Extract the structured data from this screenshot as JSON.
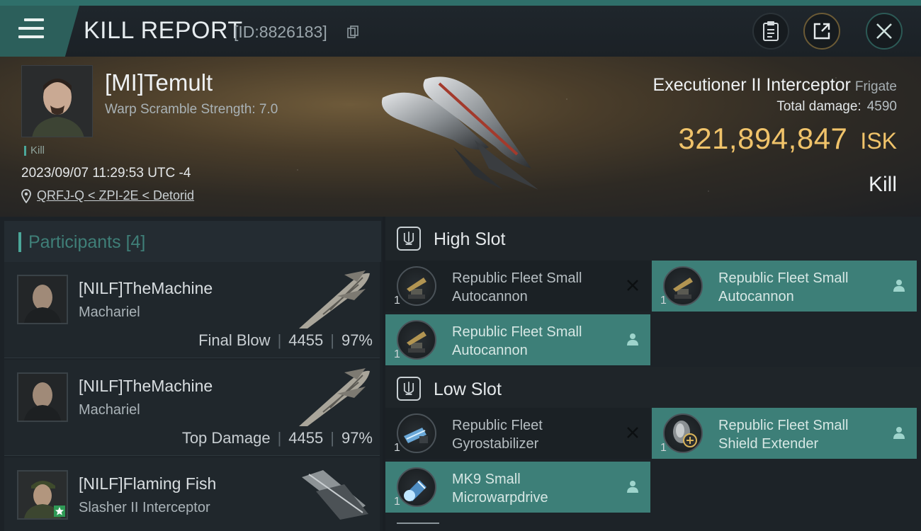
{
  "header": {
    "title": "KILL REPORT",
    "report_id": "[ID:8826183]",
    "menu_icon": "hamburger-menu-icon",
    "buttons": [
      "clipboard-icon",
      "share-icon",
      "close-icon"
    ]
  },
  "victim": {
    "pilot_name": "[MI]Temult",
    "warp_scramble": "Warp Scramble Strength: 7.0",
    "tag": "Kill",
    "datetime": "2023/09/07 11:29:53 UTC -4",
    "location": "QRFJ-Q < ZPI-2E < Detorid",
    "ship_name": "Executioner II Interceptor",
    "ship_class": "Frigate",
    "total_damage_label": "Total damage:",
    "total_damage": "4590",
    "isk_value": "321,894,847",
    "isk_unit": "ISK",
    "result": "Kill"
  },
  "participants": {
    "header": "Participants",
    "count": "[4]",
    "items": [
      {
        "name": "[NILF]TheMachine",
        "ship": "Machariel",
        "role": "Final Blow",
        "damage": "4455",
        "percent": "97%"
      },
      {
        "name": "[NILF]TheMachine",
        "ship": "Machariel",
        "role": "Top Damage",
        "damage": "4455",
        "percent": "97%"
      },
      {
        "name": "[NILF]Flaming Fish",
        "ship": "Slasher II Interceptor",
        "role": "",
        "damage": "",
        "percent": ""
      }
    ]
  },
  "slots": {
    "high": {
      "label": "High Slot",
      "modules": [
        {
          "qty": "1",
          "line1": "Republic Fleet Small",
          "line2": "Autocannon",
          "status": "destroyed",
          "active": false
        },
        {
          "qty": "1",
          "line1": "Republic Fleet Small",
          "line2": "Autocannon",
          "status": "dropped",
          "active": true
        },
        {
          "qty": "1",
          "line1": "Republic Fleet Small",
          "line2": "Autocannon",
          "status": "dropped",
          "active": true
        }
      ]
    },
    "low": {
      "label": "Low Slot",
      "modules": [
        {
          "qty": "1",
          "line1": "Republic Fleet",
          "line2": "Gyrostabilizer",
          "status": "destroyed",
          "active": false
        },
        {
          "qty": "1",
          "line1": "Republic Fleet Small",
          "line2": "Shield Extender",
          "status": "dropped",
          "active": true
        },
        {
          "qty": "1",
          "line1": "MK9 Small",
          "line2": "Microwarpdrive",
          "status": "dropped",
          "active": true
        }
      ]
    }
  },
  "colors": {
    "accent_teal": "#3d7f78",
    "isk_gold": "#f0c36a"
  }
}
